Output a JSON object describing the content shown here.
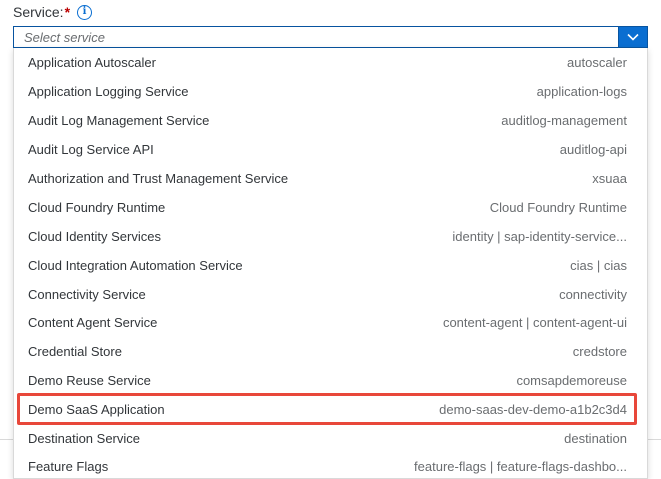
{
  "field": {
    "label": "Service:",
    "required_marker": "*",
    "info_icon": "info-icon",
    "placeholder": "Select service",
    "dropdown_icon": "chevron-down-icon"
  },
  "items": [
    {
      "title": "Application Autoscaler",
      "desc": "autoscaler"
    },
    {
      "title": "Application Logging Service",
      "desc": "application-logs"
    },
    {
      "title": "Audit Log Management Service",
      "desc": "auditlog-management"
    },
    {
      "title": "Audit Log Service API",
      "desc": "auditlog-api"
    },
    {
      "title": "Authorization and Trust Management Service",
      "desc": "xsuaa"
    },
    {
      "title": "Cloud Foundry Runtime",
      "desc": "Cloud Foundry Runtime"
    },
    {
      "title": "Cloud Identity Services",
      "desc": "identity | sap-identity-service..."
    },
    {
      "title": "Cloud Integration Automation Service",
      "desc": "cias | cias"
    },
    {
      "title": "Connectivity Service",
      "desc": "connectivity"
    },
    {
      "title": "Content Agent Service",
      "desc": "content-agent | content-agent-ui"
    },
    {
      "title": "Credential Store",
      "desc": "credstore"
    },
    {
      "title": "Demo Reuse Service",
      "desc": "comsapdemoreuse"
    },
    {
      "title": "Demo SaaS Application",
      "desc": "demo-saas-dev-demo-a1b2c3d4"
    },
    {
      "title": "Destination Service",
      "desc": "destination"
    },
    {
      "title": "Feature Flags",
      "desc": "feature-flags | feature-flags-dashbo..."
    }
  ],
  "highlighted_item": "Demo SaaS Application",
  "colors": {
    "accent": "#0a6ed1",
    "highlight_border": "#e8473a",
    "required": "#bb0000"
  }
}
